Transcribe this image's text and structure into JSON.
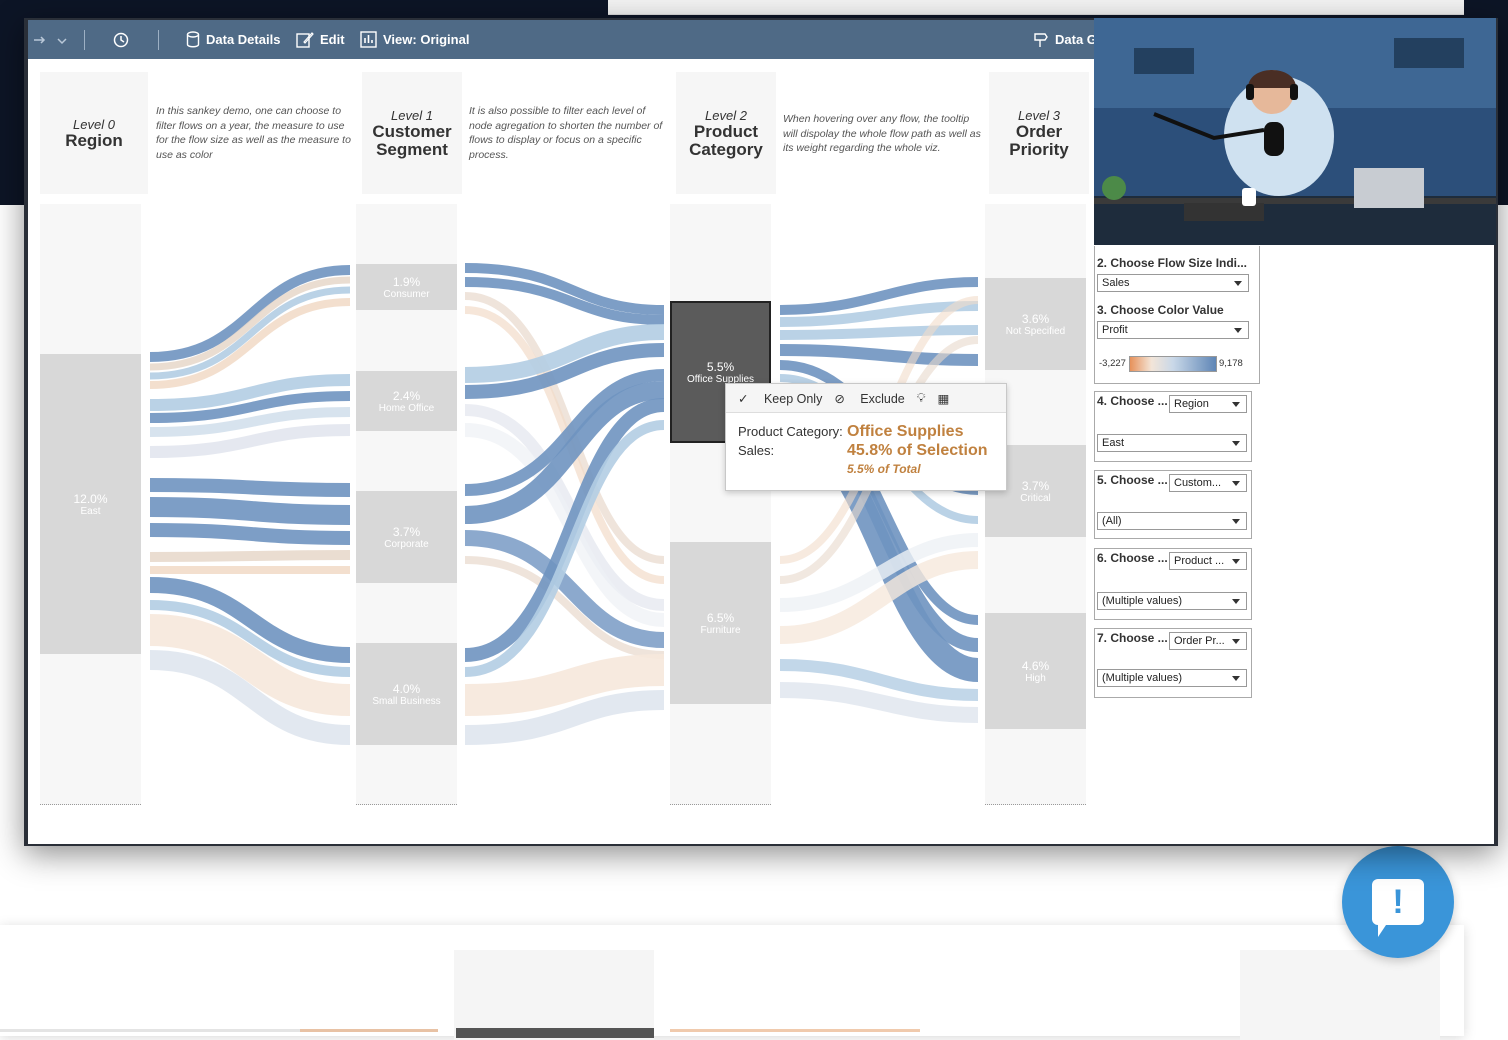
{
  "toolbar": {
    "data_details": "Data Details",
    "edit": "Edit",
    "view": "View: Original",
    "data_guide": "Data G"
  },
  "levels": [
    {
      "level": "Level 0",
      "title": "Region"
    },
    {
      "level": "Level 1",
      "title": "Customer Segment"
    },
    {
      "level": "Level 2",
      "title": "Product Category"
    },
    {
      "level": "Level 3",
      "title": "Order Priority"
    }
  ],
  "descriptions": [
    "In this sankey demo, one can choose to filter flows on a year, the measure to use for the flow size as well as the measure to use as color",
    "It is also possible to filter each level of node agregation to shorten the number of flows to display or focus on a specific process.",
    "When hovering over any flow, the tooltip will dispolay the whole flow path as well as its weight regarding the whole viz."
  ],
  "nodes": {
    "region": [
      {
        "pct": "12.0%",
        "name": "East"
      }
    ],
    "segment": [
      {
        "pct": "1.9%",
        "name": "Consumer"
      },
      {
        "pct": "2.4%",
        "name": "Home Office"
      },
      {
        "pct": "3.7%",
        "name": "Corporate"
      },
      {
        "pct": "4.0%",
        "name": "Small Business"
      }
    ],
    "category": [
      {
        "pct": "5.5%",
        "name": "Office Supplies"
      },
      {
        "pct": "6.5%",
        "name": "Furniture"
      }
    ],
    "priority": [
      {
        "pct": "3.6%",
        "name": "Not Specified"
      },
      {
        "pct": "3.7%",
        "name": "Critical"
      },
      {
        "pct": "4.6%",
        "name": "High"
      }
    ]
  },
  "tooltip": {
    "keep_only": "Keep Only",
    "exclude": "Exclude",
    "label_category": "Product Category:",
    "label_sales": "Sales:",
    "value_category": "Office Supplies",
    "value_selection": "45.8% of Selection",
    "value_total": "5.5% of Total"
  },
  "controls": {
    "flow_size_label": "2. Choose Flow Size Indi...",
    "flow_size_value": "Sales",
    "color_label": "3. Choose Color Value",
    "color_value": "Profit",
    "legend_min": "-3,227",
    "legend_max": "9,178",
    "c4_label": "4. Choose ...",
    "c4_dim": "Region",
    "c4_value": "East",
    "c5_label": "5. Choose ...",
    "c5_dim": "Custom...",
    "c5_value": "(All)",
    "c6_label": "6. Choose ...",
    "c6_dim": "Product ...",
    "c6_value": "(Multiple values)",
    "c7_label": "7. Choose ...",
    "c7_dim": "Order Pr...",
    "c7_value": "(Multiple values)"
  },
  "colors": {
    "toolbar": "#4f6a86",
    "blue_flow": "#6f94c0",
    "light_blue_flow": "#b3cde3",
    "peach_flow": "#f2dcc9",
    "tooltip_accent": "#c0813f",
    "chat_button": "#3a95d9"
  }
}
